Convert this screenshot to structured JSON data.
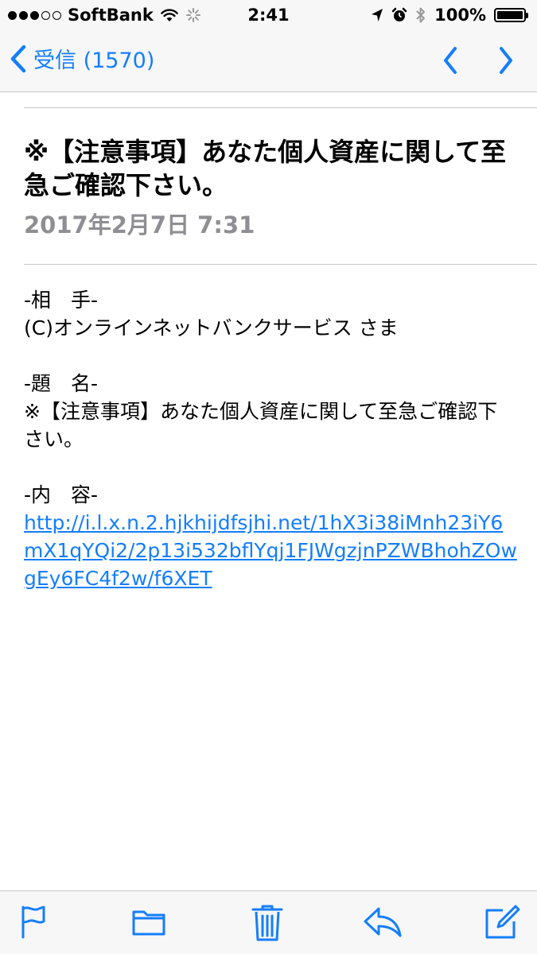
{
  "status_bar": {
    "carrier": "SoftBank",
    "time": "2:41",
    "battery": "100%",
    "battery_level": 1.0,
    "signal_bars": 3,
    "signal_total": 5
  },
  "nav": {
    "back_label": "受信 (1570)",
    "icons": [
      "chevron-left-icon",
      "chevron-up-icon",
      "chevron-down-icon"
    ]
  },
  "message": {
    "subject": "※【注意事項】あなた個人資産に関して至急ご確認下さい。",
    "date": "2017年2月7日 7:31",
    "body_lines": [
      "-相　手-",
      "(C)オンラインネットバンクサービス さま",
      "",
      "-題　名-",
      "※【注意事項】あなた個人資産に関して至急ご確認下さい。",
      "",
      "-内　容-"
    ],
    "link": "http://i.l.x.n.2.hjkhijdfsjhi.net/1hX3i38iMnh23iY6mX1qYQi2/2p13i532bflYqj1FJWgzjnPZWBhohZOwgEy6FC4f2w/f6XET"
  },
  "toolbar": {
    "icons": [
      "flag-icon",
      "folder-icon",
      "trash-icon",
      "reply-icon",
      "compose-icon"
    ]
  },
  "colors": {
    "accent": "#147efb",
    "secondary_text": "#8e8e93",
    "bar_background": "#f7f7f7"
  }
}
